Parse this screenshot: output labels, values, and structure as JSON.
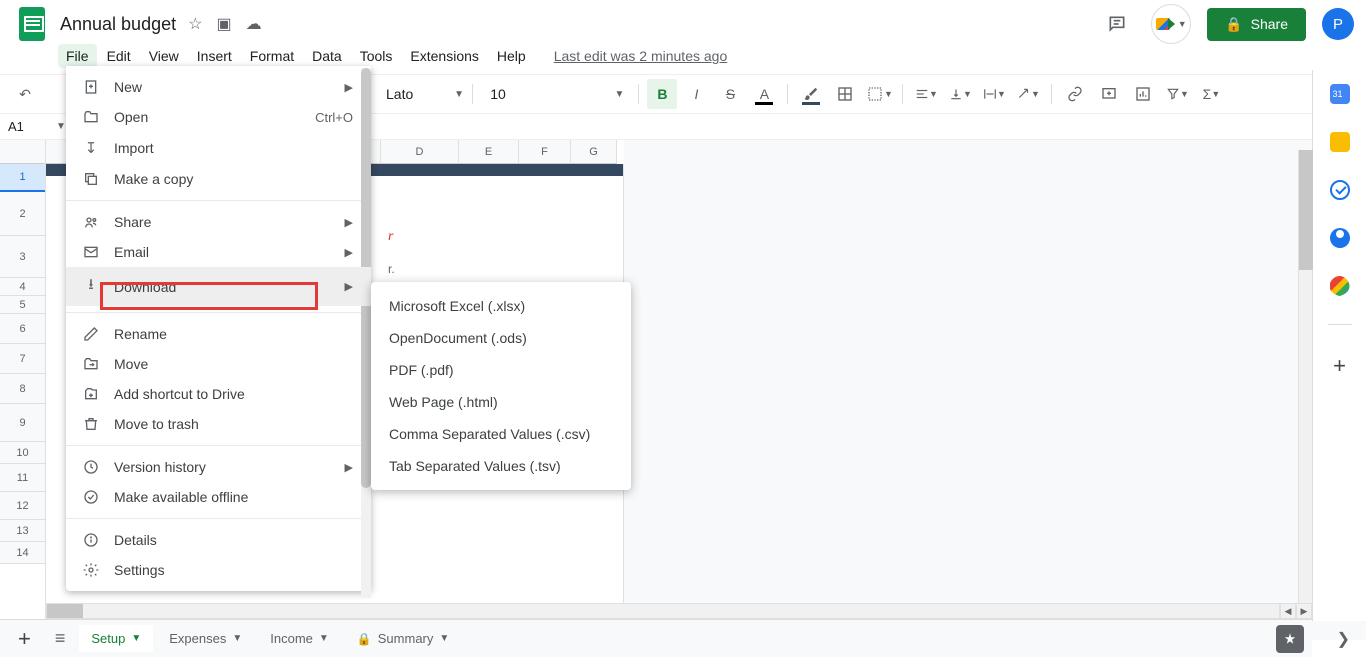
{
  "doc": {
    "title": "Annual budget"
  },
  "menubar": {
    "items": [
      "File",
      "Edit",
      "View",
      "Insert",
      "Format",
      "Data",
      "Tools",
      "Extensions",
      "Help"
    ],
    "last_edit": "Last edit was 2 minutes ago"
  },
  "share": {
    "label": "Share"
  },
  "avatar": {
    "initial": "P"
  },
  "toolbar": {
    "font_name": "Lato",
    "font_size": "10"
  },
  "namebox": {
    "ref": "A1"
  },
  "columns": {
    "D": "D",
    "E": "E",
    "F": "F",
    "G": "G"
  },
  "rows": [
    "1",
    "2",
    "3",
    "4",
    "5",
    "6",
    "7",
    "8",
    "9",
    "10",
    "11",
    "12",
    "13",
    "14"
  ],
  "cell_text": {
    "red_fragment": "r",
    "grey_fragment": "r."
  },
  "file_menu": {
    "items": [
      {
        "icon": "new-icon",
        "label": "New",
        "submenu": true
      },
      {
        "icon": "open-icon",
        "label": "Open",
        "shortcut": "Ctrl+O"
      },
      {
        "icon": "import-icon",
        "label": "Import"
      },
      {
        "icon": "copy-icon",
        "label": "Make a copy"
      },
      {
        "sep": true
      },
      {
        "icon": "share-icon",
        "label": "Share",
        "submenu": true
      },
      {
        "icon": "email-icon",
        "label": "Email",
        "submenu": true
      },
      {
        "icon": "download-icon",
        "label": "Download",
        "submenu": true,
        "hover": true
      },
      {
        "sep": true
      },
      {
        "icon": "rename-icon",
        "label": "Rename"
      },
      {
        "icon": "move-icon",
        "label": "Move"
      },
      {
        "icon": "shortcut-icon",
        "label": "Add shortcut to Drive"
      },
      {
        "icon": "trash-icon",
        "label": "Move to trash"
      },
      {
        "sep": true
      },
      {
        "icon": "history-icon",
        "label": "Version history",
        "submenu": true
      },
      {
        "icon": "offline-icon",
        "label": "Make available offline"
      },
      {
        "sep": true
      },
      {
        "icon": "details-icon",
        "label": "Details"
      },
      {
        "icon": "settings-icon",
        "label": "Settings"
      }
    ]
  },
  "download_submenu": {
    "items": [
      "Microsoft Excel (.xlsx)",
      "OpenDocument (.ods)",
      "PDF (.pdf)",
      "Web Page (.html)",
      "Comma Separated Values (.csv)",
      "Tab Separated Values (.tsv)"
    ]
  },
  "sheet_tabs": {
    "items": [
      {
        "label": "Setup",
        "active": true
      },
      {
        "label": "Expenses"
      },
      {
        "label": "Income"
      },
      {
        "label": "Summary"
      }
    ]
  },
  "icons": {
    "lock": "🔒",
    "star": "☆",
    "folder_move": "⧉",
    "cloud": "☁",
    "comment": "💬",
    "undo": "↶",
    "redo": "↷"
  }
}
